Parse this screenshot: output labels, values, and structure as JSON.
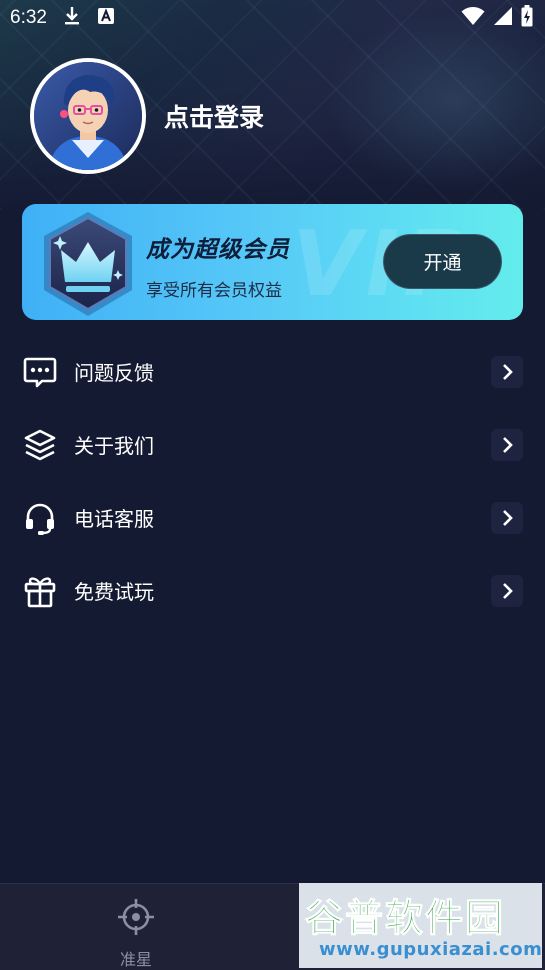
{
  "status_bar": {
    "time": "6:32",
    "icons": [
      "download-icon",
      "keyboard-a-icon",
      "wifi-icon",
      "signal-icon",
      "battery-charging-icon"
    ]
  },
  "profile": {
    "login_text": "点击登录",
    "avatar": "avatar-cartoon-boy-glasses"
  },
  "vip": {
    "title": "成为超级会员",
    "subtitle": "享受所有会员权益",
    "button_label": "开通",
    "badge_icon": "crown-icon",
    "watermark": "VIP",
    "colors": {
      "start": "#3fb0f6",
      "end": "#63ecec",
      "button": "#1a3a4a"
    }
  },
  "menu": {
    "items": [
      {
        "label": "问题反馈",
        "icon": "message-dots-icon"
      },
      {
        "label": "关于我们",
        "icon": "layers-icon"
      },
      {
        "label": "电话客服",
        "icon": "headset-icon"
      },
      {
        "label": "免费试玩",
        "icon": "gift-icon"
      }
    ]
  },
  "bottom_nav": {
    "tabs": [
      {
        "label": "准星",
        "icon": "crosshair-icon"
      }
    ]
  },
  "watermark": {
    "title": "谷普软件园",
    "url": "www.gupuxiazai.com"
  },
  "colors": {
    "background": "#151a33",
    "nav_background": "#1f2236"
  }
}
